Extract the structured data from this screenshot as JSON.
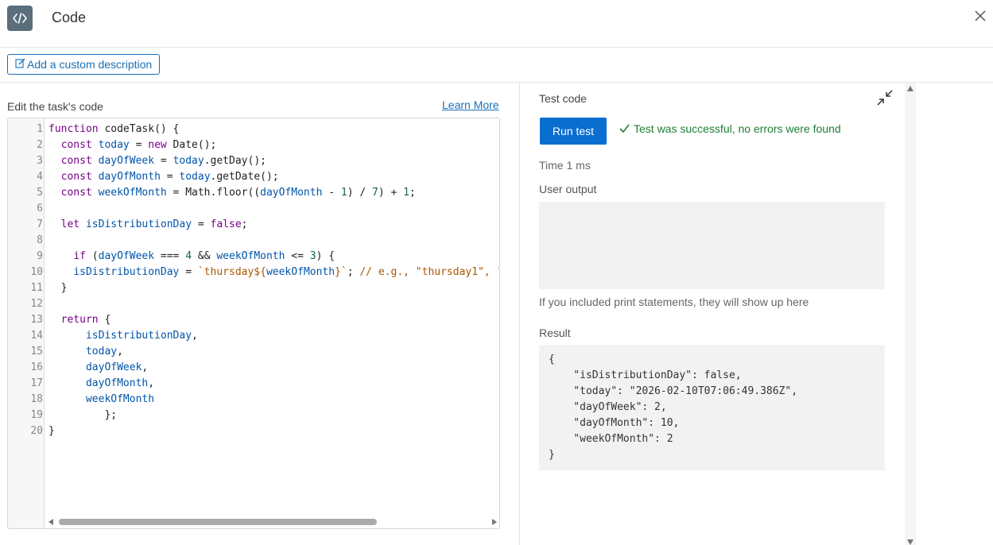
{
  "header": {
    "title": "Code",
    "icon": "code-icon",
    "close_icon": "close-icon"
  },
  "description": {
    "button_label": "Add a custom description",
    "icon": "edit-icon"
  },
  "editor": {
    "label": "Edit the task's code",
    "learn_more": "Learn More",
    "line_numbers": [
      "1",
      "2",
      "3",
      "4",
      "5",
      "6",
      "7",
      "8",
      "9",
      "10",
      "11",
      "12",
      "13",
      "14",
      "15",
      "16",
      "17",
      "18",
      "19",
      "20"
    ],
    "lines": [
      "function codeTask() {",
      "  const today = new Date();",
      "  const dayOfWeek = today.getDay();",
      "  const dayOfMonth = today.getDate();",
      "  const weekOfMonth = Math.floor((dayOfMonth - 1) / 7) + 1;",
      "",
      "  let isDistributionDay = false;",
      "",
      "    if (dayOfWeek === 4 && weekOfMonth <= 3) {",
      "    isDistributionDay = `thursday${weekOfMonth}`; // e.g., \"thursday1\", \"t",
      "  }",
      "",
      "  return {",
      "      isDistributionDay,",
      "      today,",
      "      dayOfWeek,",
      "      dayOfMonth,",
      "      weekOfMonth",
      "         };",
      "}"
    ]
  },
  "test": {
    "label": "Test code",
    "collapse_icon": "collapse-icon",
    "run_button": "Run test",
    "success_message": "Test was successful, no errors were found",
    "time": "Time 1 ms",
    "user_output_label": "User output",
    "user_output_value": "",
    "print_hint": "If you included print statements, they will show up here",
    "result_label": "Result",
    "result_lines": [
      "{",
      "    \"isDistributionDay\": false,",
      "    \"today\": \"2026-02-10T07:06:49.386Z\",",
      "    \"dayOfWeek\": 2,",
      "    \"dayOfMonth\": 10,",
      "    \"weekOfMonth\": 2",
      "}"
    ]
  },
  "colors": {
    "accent": "#0a6ed1",
    "link": "#1a6fb4",
    "success": "#1e7e34",
    "icon_bg": "#5a6e7c"
  }
}
